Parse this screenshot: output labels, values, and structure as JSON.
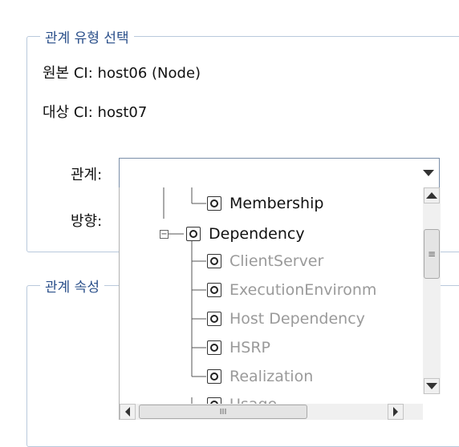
{
  "section1": {
    "legend": "관계 유형 선택",
    "source_ci_label": "원본 CI:",
    "source_ci_value": "host06 (Node)",
    "target_ci_label": "대상 CI:",
    "target_ci_value": "host07",
    "relation_label": "관계:",
    "relation_value": "",
    "direction_label": "방향:"
  },
  "section2": {
    "legend": "관계 속성"
  },
  "tree": {
    "items": [
      {
        "label": "Membership",
        "state": "enabled"
      },
      {
        "label": "Dependency",
        "state": "enabled",
        "expander": "−"
      },
      {
        "label": "ClientServer",
        "state": "disabled"
      },
      {
        "label": "ExecutionEnvironm",
        "state": "disabled"
      },
      {
        "label": "Host Dependency",
        "state": "disabled"
      },
      {
        "label": "HSRP",
        "state": "disabled"
      },
      {
        "label": "Realization",
        "state": "disabled"
      },
      {
        "label": "Usage",
        "state": "disabled"
      }
    ]
  },
  "scrollbars": {
    "vthumb_grip": "≡",
    "hthumb_grip": "III"
  },
  "colors": {
    "legend": "#2a4f8a",
    "enabled_text": "#111111",
    "disabled_text": "#9a9a9a",
    "frame_border": "#b9c9dc"
  }
}
